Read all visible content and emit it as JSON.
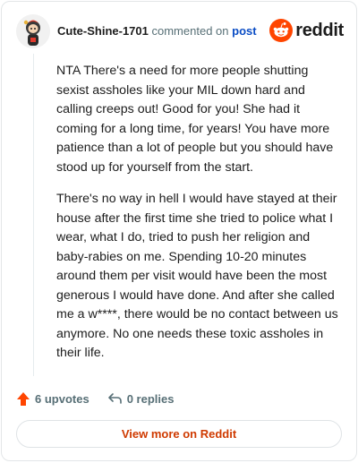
{
  "comment": {
    "username": "Cute-Shine-1701",
    "action_text": "commented on",
    "post_link": "post",
    "paragraphs": [
      "NTA There's a need for more people shutting sexist assholes like your MIL down hard and calling creeps out! Good for you! She had it coming for a long time, for years! You have more patience than a lot of people but you should have stood up for yourself from the start.",
      "There's no way in hell I would have stayed at their house after the first time she tried to police what I wear, what I do, tried to push her religion and baby-rabies on me. Spending 10-20 minutes around them per visit would have been the most generous I would have done. And after she called me a w****, there would be no contact between us anymore. No one needs these toxic assholes in their life."
    ]
  },
  "logo": {
    "text": "reddit",
    "icon": "reddit-snoo-icon",
    "color": "#ff4500"
  },
  "actions": {
    "upvotes_label": "6 upvotes",
    "upvote_icon": "upvote-arrow-icon",
    "replies_label": "0 replies",
    "reply_icon": "reply-arrow-icon"
  },
  "footer": {
    "view_more_label": "View more on Reddit"
  },
  "colors": {
    "accent": "#ff4500",
    "link": "#0b4dc5",
    "muted": "#576f76",
    "view_more": "#cf3a00"
  }
}
